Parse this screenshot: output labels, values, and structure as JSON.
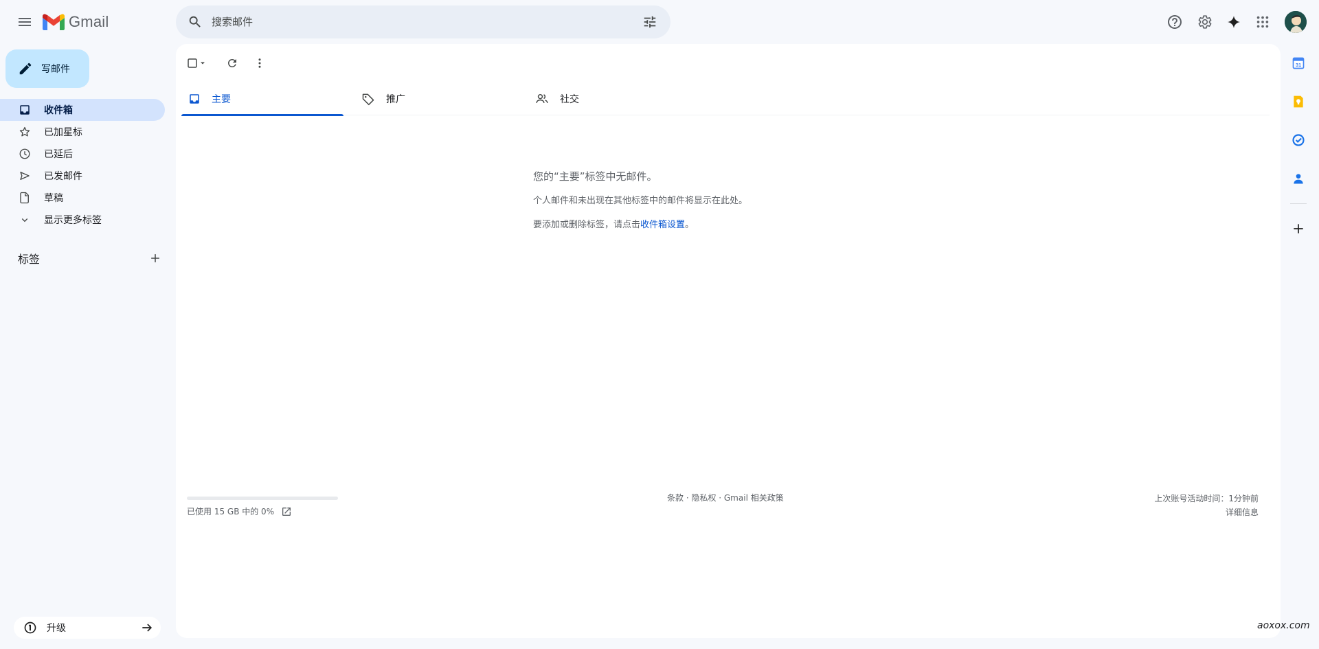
{
  "header": {
    "app_name": "Gmail",
    "search_placeholder": "搜索邮件"
  },
  "sidebar": {
    "compose_label": "写邮件",
    "items": [
      {
        "label": "收件箱",
        "icon": "inbox-icon",
        "active": true
      },
      {
        "label": "已加星标",
        "icon": "star-icon"
      },
      {
        "label": "已延后",
        "icon": "clock-icon"
      },
      {
        "label": "已发邮件",
        "icon": "send-icon"
      },
      {
        "label": "草稿",
        "icon": "draft-icon"
      },
      {
        "label": "显示更多标签",
        "icon": "chevron-down-icon"
      }
    ],
    "labels_title": "标签",
    "upgrade_label": "升级"
  },
  "tabs": [
    {
      "label": "主要",
      "icon": "inbox-icon",
      "active": true
    },
    {
      "label": "推广",
      "icon": "tag-icon"
    },
    {
      "label": "社交",
      "icon": "people-icon"
    }
  ],
  "empty_state": {
    "title": "您的“主要”标签中无邮件。",
    "line1": "个人邮件和未出现在其他标签中的邮件将显示在此处。",
    "line2_prefix": "要添加或删除标签，请点击",
    "line2_link": "收件箱设置",
    "line2_suffix": "。"
  },
  "footer": {
    "storage_text": "已使用 15 GB 中的 0%",
    "storage_fraction": 0,
    "links": "条款 · 隐私权 · Gmail 相关政策",
    "last_activity": "上次账号活动时间：1分钟前",
    "details": "详细信息"
  },
  "watermark": "aoxox.com",
  "colors": {
    "accent": "#0b57d0",
    "compose_bg": "#c2e7ff",
    "active_nav_bg": "#d3e3fd",
    "page_bg": "#f6f8fc"
  }
}
